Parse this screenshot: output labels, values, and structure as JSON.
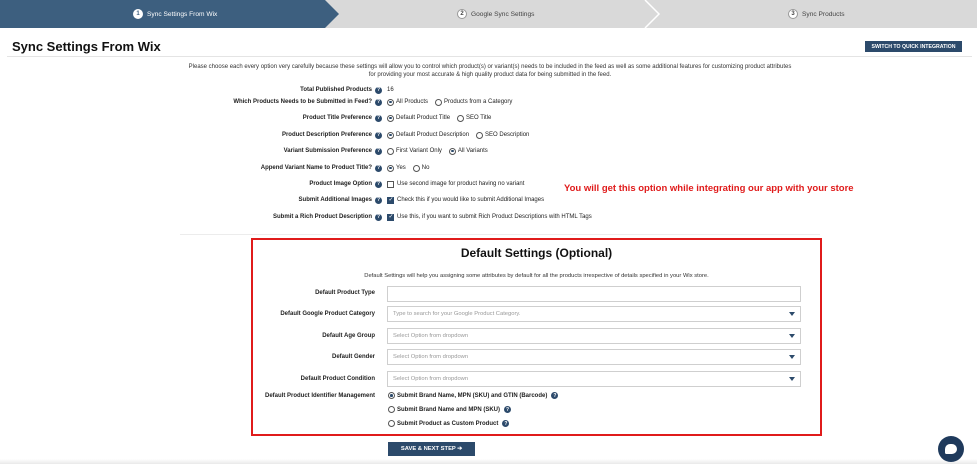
{
  "steps": [
    {
      "num": "1",
      "label": "Sync Settings From Wix",
      "active": true
    },
    {
      "num": "2",
      "label": "Google Sync Settings",
      "active": false
    },
    {
      "num": "3",
      "label": "Sync Products",
      "active": false
    }
  ],
  "colors": {
    "accent": "#2c4a6b",
    "highlight": "#e01b1b",
    "step_active": "#3d5f7f",
    "step_bg": "#d9d9d9"
  },
  "page": {
    "title": "Sync Settings From Wix",
    "quick_button": "SWITCH TO QUICK INTEGRATION",
    "intro_1": "Please choose each every option very carefully because these settings will allow you to control which product(s) or variant(s) needs to be included in the feed as well as some additional features for customizing product attributes",
    "intro_2": "for providing your most accurate & high quality product data for being submitted in the feed."
  },
  "settings": {
    "total": {
      "label": "Total Published Products",
      "value": "16"
    },
    "which": {
      "label": "Which Products Needs to be Submitted in Feed?",
      "opt1": "All Products",
      "opt2": "Products from a Category"
    },
    "title_pref": {
      "label": "Product Title Preference",
      "opt1": "Default Product Title",
      "opt2": "SEO Title"
    },
    "desc_pref": {
      "label": "Product Description Preference",
      "opt1": "Default Product Description",
      "opt2": "SEO Description"
    },
    "variant": {
      "label": "Variant Submission Preference",
      "opt1": "First Variant Only",
      "opt2": "All Variants"
    },
    "append": {
      "label": "Append Variant Name to Product Title?",
      "opt1": "Yes",
      "opt2": "No"
    },
    "image": {
      "label": "Product Image Option",
      "text": "Use second image for product having no variant"
    },
    "additional": {
      "label": "Submit Additional Images",
      "text": "Check this if you would like to submit Additional Images"
    },
    "rich": {
      "label": "Submit a Rich Product Description",
      "text": "Use this, if you want to submit Rich Product Descriptions with HTML Tags"
    }
  },
  "callout": "You will get this option while integrating our app with your store",
  "defaults": {
    "title": "Default Settings (Optional)",
    "description": "Default Settings will help you assigning some attributes by default for all the products irrespective of details specified in your Wix store.",
    "product_type": {
      "label": "Default Product Type",
      "value": ""
    },
    "google_category": {
      "label": "Default Google Product Category",
      "placeholder": "Type to search for your Google Product Category."
    },
    "age_group": {
      "label": "Default Age Group",
      "placeholder": "Select Option from dropdown"
    },
    "gender": {
      "label": "Default Gender",
      "placeholder": "Select Option from dropdown"
    },
    "condition": {
      "label": "Default Product Condition",
      "placeholder": "Select Option from dropdown"
    },
    "identifier": {
      "label": "Default Product Identifier Management",
      "opt1": "Submit Brand Name, MPN (SKU) and GTIN (Barcode)",
      "opt2": "Submit Brand Name and MPN (SKU)",
      "opt3": "Submit Product as Custom Product"
    }
  },
  "save_button": "SAVE & NEXT STEP ➔"
}
